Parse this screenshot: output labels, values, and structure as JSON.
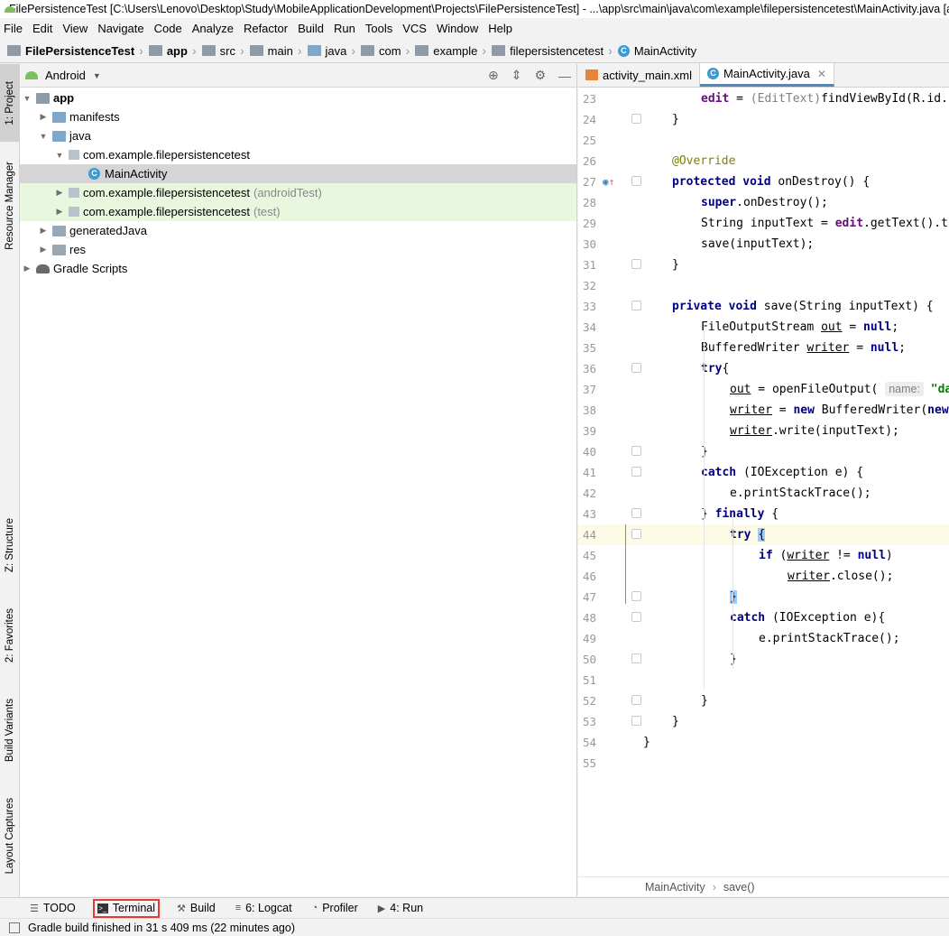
{
  "window": {
    "title": "FilePersistenceTest [C:\\Users\\Lenovo\\Desktop\\Study\\MobileApplicationDevelopment\\Projects\\FilePersistenceTest] - ...\\app\\src\\main\\java\\com\\example\\filepersistencetest\\MainActivity.java [app] - Android Studio"
  },
  "menu": [
    "File",
    "Edit",
    "View",
    "Navigate",
    "Code",
    "Analyze",
    "Refactor",
    "Build",
    "Run",
    "Tools",
    "VCS",
    "Window",
    "Help"
  ],
  "breadcrumb": [
    "FilePersistenceTest",
    "app",
    "src",
    "main",
    "java",
    "com",
    "example",
    "filepersistencetest",
    "MainActivity"
  ],
  "left_tools": [
    "1: Project",
    "Resource Manager",
    "Z: Structure",
    "2: Favorites",
    "Build Variants",
    "Layout Captures"
  ],
  "project": {
    "view_mode": "Android",
    "tree": [
      {
        "label": "app",
        "suffix": ""
      },
      {
        "label": "manifests",
        "suffix": ""
      },
      {
        "label": "java",
        "suffix": ""
      },
      {
        "label": "com.example.filepersistencetest",
        "suffix": ""
      },
      {
        "label": "MainActivity",
        "suffix": ""
      },
      {
        "label": "com.example.filepersistencetest",
        "suffix": "(androidTest)"
      },
      {
        "label": "com.example.filepersistencetest",
        "suffix": "(test)"
      },
      {
        "label": "generatedJava",
        "suffix": ""
      },
      {
        "label": "res",
        "suffix": ""
      },
      {
        "label": "Gradle Scripts",
        "suffix": ""
      }
    ]
  },
  "editor": {
    "tabs": [
      {
        "label": "activity_main.xml"
      },
      {
        "label": "MainActivity.java"
      }
    ],
    "line_numbers": [
      "23",
      "24",
      "25",
      "26",
      "27",
      "28",
      "29",
      "30",
      "31",
      "32",
      "33",
      "34",
      "35",
      "36",
      "37",
      "38",
      "39",
      "40",
      "41",
      "42",
      "43",
      "44",
      "45",
      "46",
      "47",
      "48",
      "49",
      "50",
      "51",
      "52",
      "53",
      "54",
      "55"
    ],
    "footer_crumbs": [
      "MainActivity",
      "save()"
    ]
  },
  "bottom_tabs": [
    "TODO",
    "Terminal",
    "Build",
    "6: Logcat",
    "Profiler",
    "4: Run"
  ],
  "status": {
    "message": "Gradle build finished in 31 s 409 ms (22 minutes ago)"
  }
}
